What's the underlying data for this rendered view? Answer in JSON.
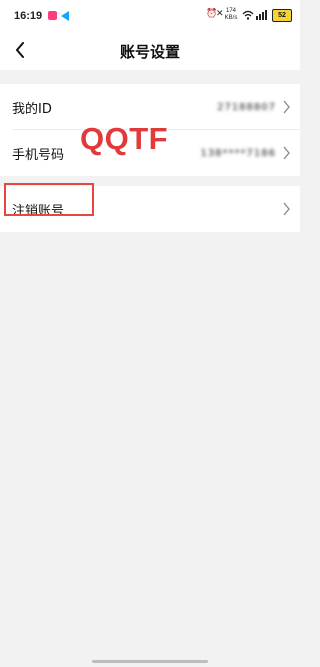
{
  "status_bar": {
    "time": "16:19",
    "network_speed": "174\nKB/s",
    "battery": "52",
    "icons": [
      "app-notification-icon",
      "send-icon",
      "alarm-icon",
      "mute-icon",
      "hd-icon",
      "wifi-icon",
      "signal-icon",
      "battery-icon"
    ]
  },
  "header": {
    "title": "账号设置",
    "back_icon": "chevron-left-icon"
  },
  "account_rows": [
    {
      "label": "我的ID",
      "value": "27188807"
    },
    {
      "label": "手机号码",
      "value": "138****7186"
    }
  ],
  "danger_rows": [
    {
      "label": "注销账号"
    }
  ],
  "watermark": "QQTF",
  "colors": {
    "background": "#f2f2f2",
    "card": "#ffffff",
    "highlight": "#e84545",
    "watermark": "#e23a3a"
  }
}
